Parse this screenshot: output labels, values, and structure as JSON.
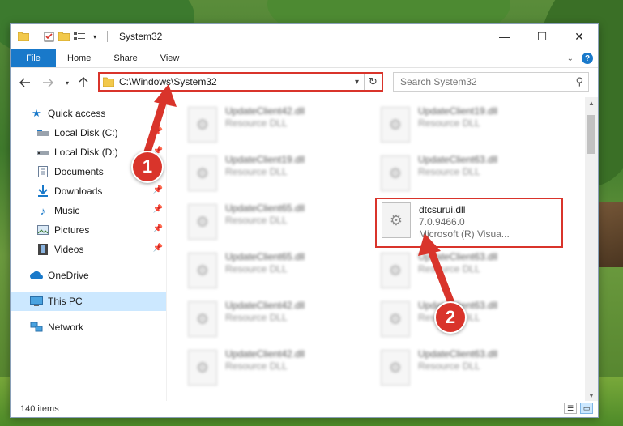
{
  "window": {
    "title": "System32",
    "controls": {
      "minimize": "—",
      "maximize": "☐",
      "close": "✕"
    }
  },
  "ribbon": {
    "tabs": [
      "File",
      "Home",
      "Share",
      "View"
    ],
    "help": "?"
  },
  "navbar": {
    "address": "C:\\Windows\\System32",
    "search_placeholder": "Search System32"
  },
  "sidebar": {
    "quick_access": "Quick access",
    "items": [
      {
        "label": "Local Disk (C:)",
        "icon": "drive-icon",
        "pinned": true
      },
      {
        "label": "Local Disk (D:)",
        "icon": "drive-icon",
        "pinned": true
      },
      {
        "label": "Documents",
        "icon": "documents-icon",
        "pinned": true
      },
      {
        "label": "Downloads",
        "icon": "download-icon",
        "pinned": true
      },
      {
        "label": "Music",
        "icon": "music-icon",
        "pinned": true
      },
      {
        "label": "Pictures",
        "icon": "pictures-icon",
        "pinned": true
      },
      {
        "label": "Videos",
        "icon": "videos-icon",
        "pinned": true
      }
    ],
    "onedrive": "OneDrive",
    "this_pc": "This PC",
    "network": "Network"
  },
  "files": {
    "left": [
      {
        "name": "UpdateClient42.dll",
        "sub": "Resource DLL"
      },
      {
        "name": "UpdateClient19.dll",
        "sub": "Resource DLL"
      },
      {
        "name": "UpdateClient65.dll",
        "sub": "Resource DLL"
      },
      {
        "name": "UpdateClient65.dll",
        "sub": "Resource DLL"
      },
      {
        "name": "UpdateClient42.dll",
        "sub": "Resource DLL"
      },
      {
        "name": "UpdateClient42.dll",
        "sub": "Resource DLL"
      }
    ],
    "right": [
      {
        "name": "UpdateClient19.dll",
        "sub": "Resource DLL"
      },
      {
        "name": "UpdateClient63.dll",
        "sub": "Resource DLL"
      },
      {
        "name": "UpdateClient63.dll",
        "sub": "Resource DLL"
      },
      {
        "name": "UpdateClient63.dll",
        "sub": "Resource DLL"
      },
      {
        "name": "UpdateClient63.dll",
        "sub": "Resource DLL"
      }
    ],
    "highlighted": {
      "name": "dtcsurui.dll",
      "version": "7.0.9466.0",
      "company": "Microsoft (R) Visua..."
    }
  },
  "statusbar": {
    "count": "140 items"
  },
  "annotations": {
    "step1": "1",
    "step2": "2"
  },
  "colors": {
    "accent": "#1979ca",
    "highlight": "#d9342b",
    "selected": "#cce8ff"
  }
}
